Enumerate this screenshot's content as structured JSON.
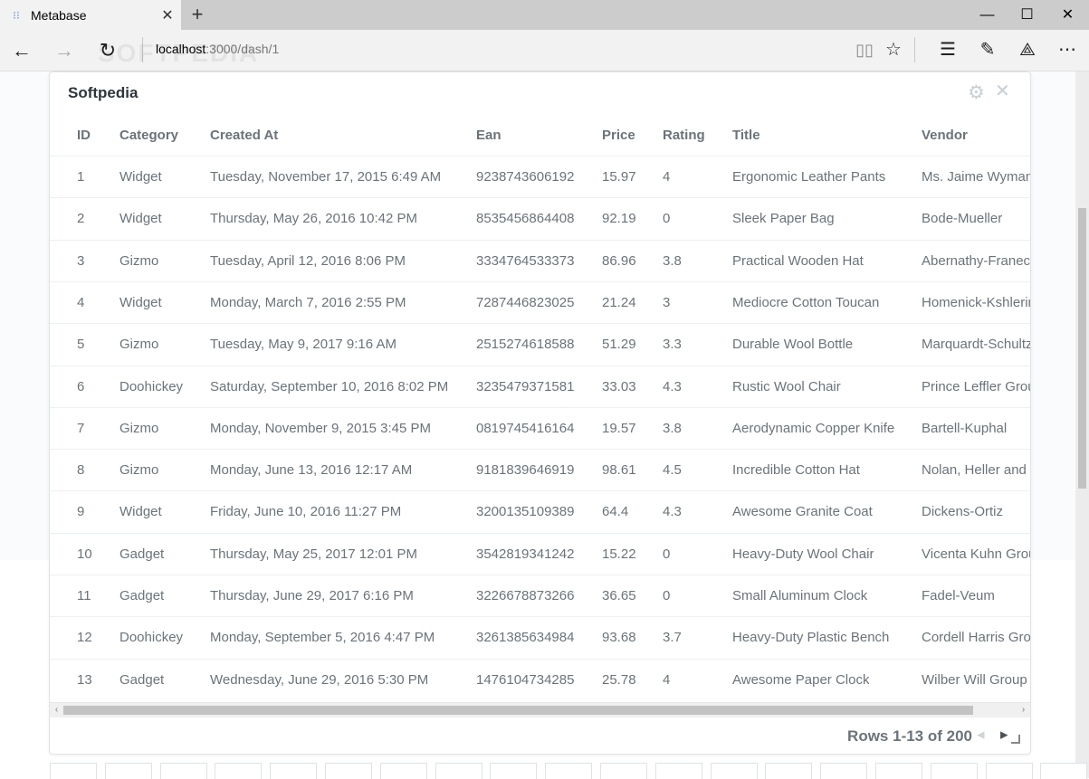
{
  "browser": {
    "tab_title": "Metabase",
    "address_host": "localhost",
    "address_path": ":3000/dash/1",
    "watermark": "SOFTPEDIA",
    "icons": {
      "favicon": "metabase-icon",
      "tab_close": "close-icon",
      "new_tab": "plus-icon",
      "back": "back-arrow-icon",
      "forward": "forward-arrow-icon",
      "refresh": "refresh-icon",
      "reading_view": "book-icon",
      "favorite": "star-icon",
      "hub": "hub-icon",
      "notes": "pen-note-icon",
      "share": "share-icon",
      "more": "more-icon"
    }
  },
  "card": {
    "title": "Softpedia",
    "columns": [
      "ID",
      "Category",
      "Created At",
      "Ean",
      "Price",
      "Rating",
      "Title",
      "Vendor"
    ],
    "rows": [
      [
        "1",
        "Widget",
        "Tuesday, November 17, 2015 6:49 AM",
        "9238743606192",
        "15.97",
        "4",
        "Ergonomic Leather Pants",
        "Ms. Jaime Wyman"
      ],
      [
        "2",
        "Widget",
        "Thursday, May 26, 2016 10:42 PM",
        "8535456864408",
        "92.19",
        "0",
        "Sleek Paper Bag",
        "Bode-Mueller"
      ],
      [
        "3",
        "Gizmo",
        "Tuesday, April 12, 2016 8:06 PM",
        "3334764533373",
        "86.96",
        "3.8",
        "Practical Wooden Hat",
        "Abernathy-Franec"
      ],
      [
        "4",
        "Widget",
        "Monday, March 7, 2016 2:55 PM",
        "7287446823025",
        "21.24",
        "3",
        "Mediocre Cotton Toucan",
        "Homenick-Kshlerin"
      ],
      [
        "5",
        "Gizmo",
        "Tuesday, May 9, 2017 9:16 AM",
        "2515274618588",
        "51.29",
        "3.3",
        "Durable Wool Bottle",
        "Marquardt-Schultz"
      ],
      [
        "6",
        "Doohickey",
        "Saturday, September 10, 2016 8:02 PM",
        "3235479371581",
        "33.03",
        "4.3",
        "Rustic Wool Chair",
        "Prince Leffler Grou"
      ],
      [
        "7",
        "Gizmo",
        "Monday, November 9, 2015 3:45 PM",
        "0819745416164",
        "19.57",
        "3.8",
        "Aerodynamic Copper Knife",
        "Bartell-Kuphal"
      ],
      [
        "8",
        "Gizmo",
        "Monday, June 13, 2016 12:17 AM",
        "9181839646919",
        "98.61",
        "4.5",
        "Incredible Cotton Hat",
        "Nolan, Heller and"
      ],
      [
        "9",
        "Widget",
        "Friday, June 10, 2016 11:27 PM",
        "3200135109389",
        "64.4",
        "4.3",
        "Awesome Granite Coat",
        "Dickens-Ortiz"
      ],
      [
        "10",
        "Gadget",
        "Thursday, May 25, 2017 12:01 PM",
        "3542819341242",
        "15.22",
        "0",
        "Heavy-Duty Wool Chair",
        "Vicenta Kuhn Grou"
      ],
      [
        "11",
        "Gadget",
        "Thursday, June 29, 2017 6:16 PM",
        "3226678873266",
        "36.65",
        "0",
        "Small Aluminum Clock",
        "Fadel-Veum"
      ],
      [
        "12",
        "Doohickey",
        "Monday, September 5, 2016 4:47 PM",
        "3261385634984",
        "93.68",
        "3.7",
        "Heavy-Duty Plastic Bench",
        "Cordell Harris Grou"
      ],
      [
        "13",
        "Gadget",
        "Wednesday, June 29, 2016 5:30 PM",
        "1476104734285",
        "25.78",
        "4",
        "Awesome Paper Clock",
        "Wilber Will Group"
      ]
    ],
    "footer": {
      "rows_label": "Rows 1-13 of 200"
    },
    "icons": {
      "settings": "gear-icon",
      "remove": "close-icon",
      "prev": "chevron-left-icon",
      "next": "chevron-right-icon"
    }
  }
}
